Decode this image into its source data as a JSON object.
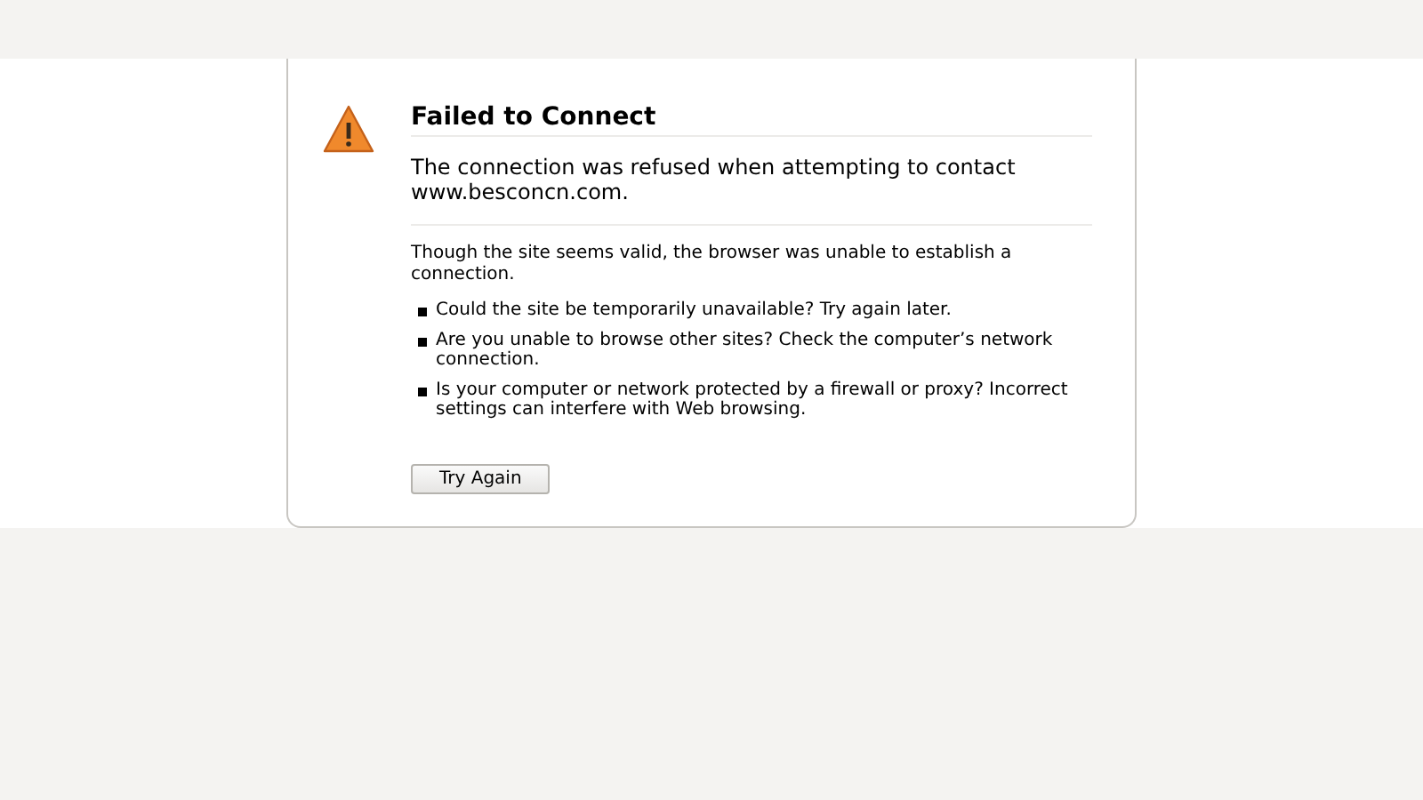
{
  "error_page": {
    "title": "Failed to Connect",
    "short_description": "The connection was refused when attempting to contact www.besconcn.com.",
    "long_description": "Though the site seems valid, the browser was unable to establish a connection.",
    "suggestions": [
      "Could the site be temporarily unavailable? Try again later.",
      "Are you unable to browse other sites? Check the computer’s network connection.",
      "Is your computer or network protected by a firewall or proxy? Incorrect settings can interfere with Web browsing."
    ],
    "button": "Try Again"
  }
}
